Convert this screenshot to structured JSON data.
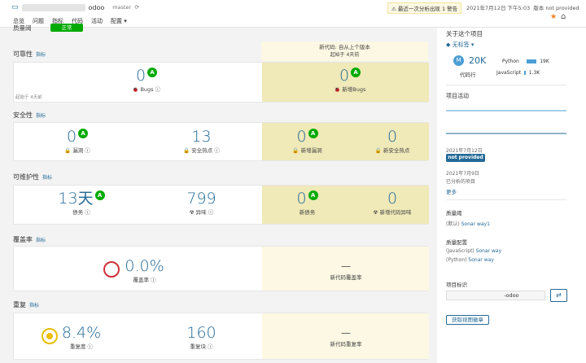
{
  "header": {
    "project_name": "odoo",
    "branch": "master",
    "nav": [
      "总览",
      "问题",
      "指标",
      "代码",
      "活动",
      "配置 ▾"
    ],
    "warning": "⚠ 最近一次分析出现 1 警告",
    "analysis_date": "2021年7月12日 下午5:03",
    "version": "版本 not provided"
  },
  "quality_gate": {
    "label": "质量阈",
    "status": "正常"
  },
  "new_code": {
    "title": "新代码: 自从上个版本",
    "since": "起始于 4天前"
  },
  "reliability": {
    "title": "可靠性",
    "history": "指标",
    "since_left": "起始于 4天前",
    "bugs": "0",
    "bugs_rating": "A",
    "bugs_label": "Bugs",
    "new_bugs": "0",
    "new_bugs_rating": "A",
    "new_bugs_label": "新增Bugs"
  },
  "security": {
    "title": "安全性",
    "history": "指标",
    "vulns": "0",
    "vulns_rating": "A",
    "vulns_label": "漏洞",
    "hotspots": "13",
    "hotspots_label": "安全热点",
    "new_vulns": "0",
    "new_vulns_rating": "A",
    "new_vulns_label": "新增漏洞",
    "new_hotspots": "0",
    "new_hotspots_label": "新安全热点"
  },
  "maintainability": {
    "title": "可维护性",
    "history": "指标",
    "debt": "13天",
    "debt_rating": "A",
    "debt_label": "债务",
    "smells": "799",
    "smells_label": "异味",
    "new_debt": "0",
    "new_debt_rating": "A",
    "new_debt_label": "新债务",
    "new_smells": "0",
    "new_smells_label": "新增代码异味"
  },
  "coverage": {
    "title": "覆盖率",
    "history": "指标",
    "value": "0.0%",
    "label": "覆盖率",
    "new_value": "—",
    "new_label": "新代码覆盖率"
  },
  "duplications": {
    "title": "重复",
    "history": "指标",
    "density": "8.4%",
    "density_label": "重复度",
    "blocks": "160",
    "blocks_label": "重复块",
    "new_value": "—",
    "new_label": "新代码重复率"
  },
  "sidebar": {
    "about": "关于这个项目",
    "tags": "无标签 ▾",
    "loc_badge": "M",
    "loc": "20K",
    "loc_label": "代码行",
    "languages": [
      {
        "name": "Python",
        "value": "19K",
        "fraction": 0.95
      },
      {
        "name": "JavaScript",
        "value": "1.3K",
        "fraction": 0.07
      }
    ],
    "activity_title": "项目活动",
    "event1_date": "2021年7月12日",
    "event1_badge": "not provided",
    "event2_date": "2021年7月9日",
    "event2_desc": "已分析的项目",
    "more": "更多",
    "qg_title": "质量阈",
    "qg_value_prefix": "(默认)",
    "qg_value": "Sonar way1",
    "qp_title": "质量配置",
    "qp_js_lang": "(JavaScript)",
    "qp_js": "Sonar way",
    "qp_py_lang": "(Python)",
    "qp_py": "Sonar way",
    "key_title": "项目标识",
    "key_value": "-odoo",
    "view_badges": "获取视图徽章"
  }
}
